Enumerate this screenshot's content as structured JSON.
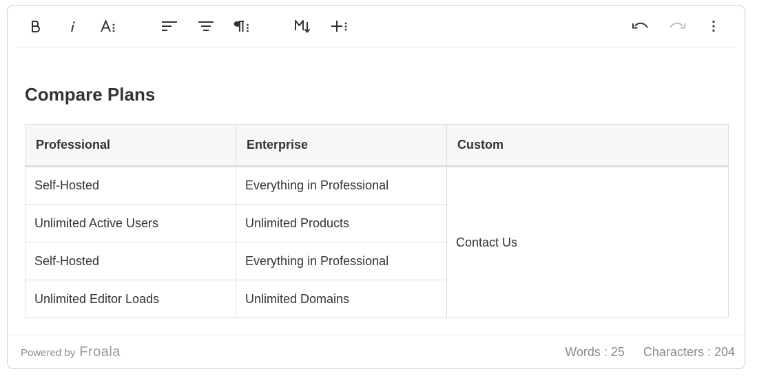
{
  "toolbar": {
    "buttons": [
      {
        "name": "bold",
        "icon": "bold-icon"
      },
      {
        "name": "italic",
        "icon": "italic-icon"
      },
      {
        "name": "text-format",
        "icon": "font-size-more-icon"
      },
      {
        "name": "align-left",
        "icon": "align-left-icon"
      },
      {
        "name": "align-center",
        "icon": "align-center-icon"
      },
      {
        "name": "paragraph-format",
        "icon": "paragraph-more-icon"
      },
      {
        "name": "markdown",
        "icon": "markdown-icon"
      },
      {
        "name": "insert-more",
        "icon": "plus-more-icon"
      },
      {
        "name": "undo",
        "icon": "undo-icon"
      },
      {
        "name": "redo",
        "icon": "redo-icon",
        "disabled": true
      },
      {
        "name": "more",
        "icon": "vertical-dots-icon"
      }
    ]
  },
  "content": {
    "title": "Compare Plans",
    "table": {
      "headers": [
        "Professional",
        "Enterprise",
        "Custom"
      ],
      "rows": [
        [
          "Self-Hosted",
          "Everything in Professional"
        ],
        [
          "Unlimited Active Users",
          "Unlimited Products"
        ],
        [
          "Self-Hosted",
          "Everything in Professional"
        ],
        [
          "Unlimited Editor Loads",
          "Unlimited Domains"
        ]
      ],
      "custom_cell": "Contact Us"
    }
  },
  "footer": {
    "powered_by": "Powered by",
    "brand": "Froala",
    "words": "Words : 25",
    "characters": "Characters : 204"
  },
  "colors": {
    "icon": "#333333",
    "icon_disabled": "#bdbdbd",
    "border": "#dddddd",
    "header_bg": "#f6f7f9",
    "muted_text": "#8a8a8a"
  }
}
